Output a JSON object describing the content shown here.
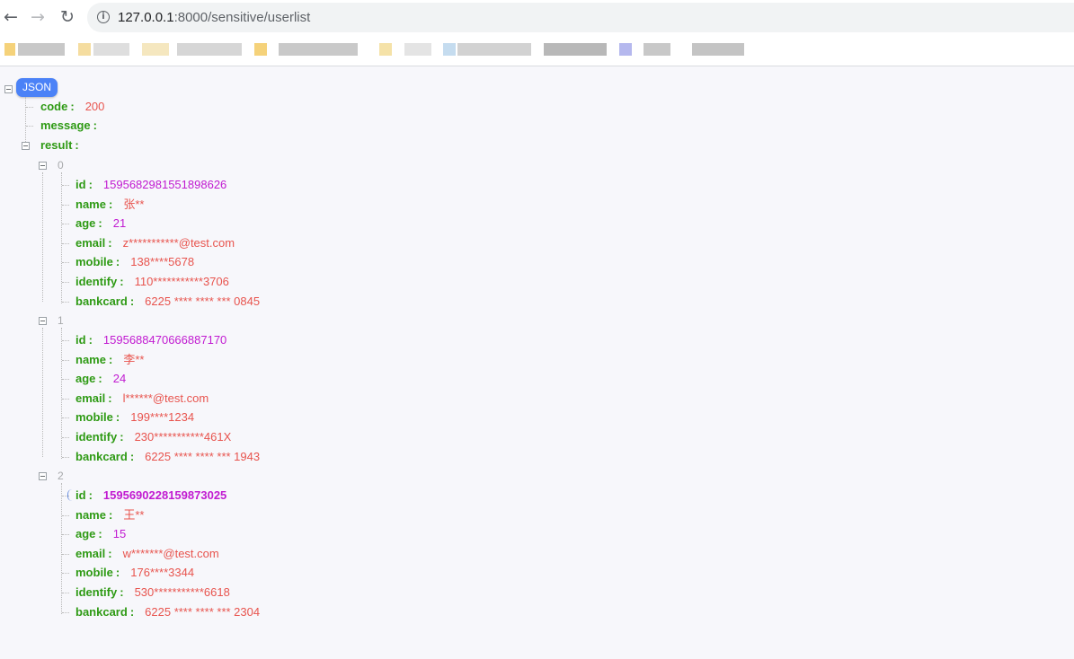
{
  "browser": {
    "url_host": "127.0.0.1",
    "url_path": ":8000/sensitive/userlist",
    "back_icon": "back-arrow-icon",
    "forward_icon": "forward-arrow-icon",
    "reload_icon": "reload-icon",
    "info_icon": "info-icon",
    "info_glyph": "i",
    "back_glyph": "←",
    "forward_glyph": "→",
    "reload_glyph": "↻"
  },
  "viewer": {
    "badge_label": "JSON",
    "root": {
      "code_key": "code",
      "code_value": "200",
      "message_key": "message",
      "message_value": "",
      "result_key": "result"
    },
    "colon": ":",
    "fields": {
      "id": "id",
      "name": "name",
      "age": "age",
      "email": "email",
      "mobile": "mobile",
      "identify": "identify",
      "bankcard": "bankcard"
    },
    "results": [
      {
        "index": "0",
        "id": "1595682981551898626",
        "name": "张**",
        "age": "21",
        "email": "z***********@test.com",
        "mobile": "138****5678",
        "identify": "110***********3706",
        "bankcard": "6225 **** **** *** 0845"
      },
      {
        "index": "1",
        "id": "1595688470666887170",
        "name": "李**",
        "age": "24",
        "email": "l******@test.com",
        "mobile": "199****1234",
        "identify": "230***********461X",
        "bankcard": "6225 **** **** *** 1943"
      },
      {
        "index": "2",
        "id": "1595690228159873025",
        "name": "王**",
        "age": "15",
        "email": "w*******@test.com",
        "mobile": "176****3344",
        "identify": "530***********6618",
        "bankcard": "6225 **** **** *** 2304"
      }
    ]
  },
  "colors": {
    "key": "#2e9a14",
    "string": "#e8544e",
    "number": "#c11bd1",
    "badge": "#4b82f7"
  }
}
